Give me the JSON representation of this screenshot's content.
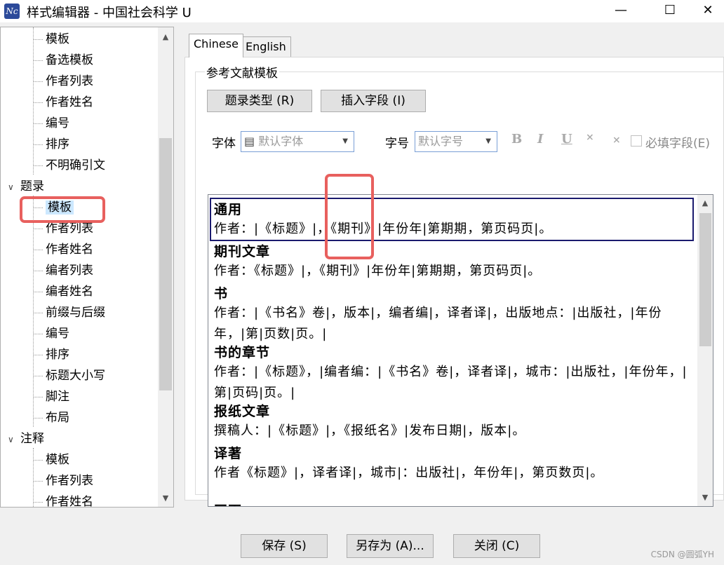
{
  "window": {
    "title": "样式编辑器 - 中国社会科学 U",
    "icon": "app-logo-icon",
    "minimize": "—",
    "maximize": "☐",
    "close": "✕"
  },
  "tree": {
    "items_top": [
      "模板",
      "备选模板",
      "作者列表",
      "作者姓名",
      "编号",
      "排序",
      "不明确引文"
    ],
    "group1": "题录",
    "items_mid": [
      "模板",
      "作者列表",
      "作者姓名",
      "编者列表",
      "编者姓名",
      "前缀与后缀",
      "编号",
      "排序",
      "标题大小写",
      "脚注",
      "布局"
    ],
    "group2": "注释",
    "items_bottom": [
      "模板",
      "作者列表",
      "作者姓名"
    ]
  },
  "tabs": [
    "Chinese",
    "English"
  ],
  "group_title": "参考文献模板",
  "buttons": {
    "ref_type": "题录类型 (R)",
    "insert_field": "插入字段 (I)"
  },
  "font": {
    "label": "字体",
    "value": "默认字体",
    "size_label": "字号",
    "size_value": "默认字号"
  },
  "format": {
    "bold": "B",
    "italic": "I",
    "underline": "U",
    "sup": "×",
    "sub": "×",
    "required": "必填字段(E)"
  },
  "entries": [
    {
      "heading": "通用",
      "text": "作者：|《标题》|，《期刊》|年份年|第期期，第页码页|。"
    },
    {
      "heading": "期刊文章",
      "text": "作者：《标题》|，《期刊》|年份年|第期期，第页码页|。"
    },
    {
      "heading": "书",
      "text": "作者：|《书名》卷|，版本|，编者编|，译者译|，出版地点：|出版社，|年份年，|第|页数|页。|"
    },
    {
      "heading": "书的章节",
      "text": "作者：|《标题》，|编者编：|《书名》卷|，译者译|，城市：|出版社，|年份年，|第|页码|页。|"
    },
    {
      "heading": "报纸文章",
      "text": "撰稿人：|《标题》|，《报纸名》|发布日期|，版本|。"
    },
    {
      "heading": "译著",
      "text": "作者《标题》|，译者译|，城市|：出版社|，年份年|，第页数页|。"
    },
    {
      "heading": "网页",
      "text": ""
    }
  ],
  "bottom": {
    "save": "保存 (S)",
    "save_as": "另存为 (A)...",
    "close": "关闭 (C)"
  },
  "watermark": "CSDN @圆弧YH",
  "colors": {
    "highlight": "#e8605e",
    "selection": "#cce8ff",
    "entry_border": "#1a1a6e"
  }
}
